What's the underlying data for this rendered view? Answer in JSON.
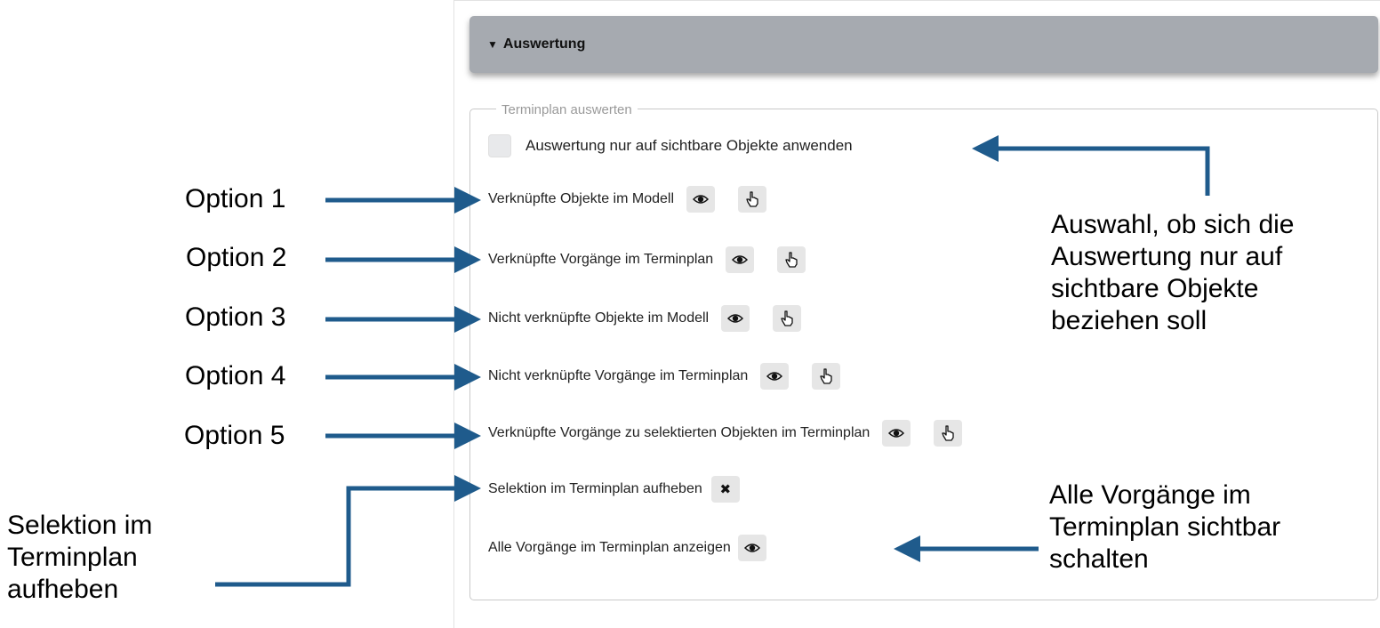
{
  "accordion": {
    "toggle_glyph": "▼",
    "title": "Auswertung"
  },
  "fieldset": {
    "legend": "Terminplan auswerten",
    "checkbox_label": "Auswertung nur auf sichtbare Objekte anwenden",
    "checked": false
  },
  "rows": [
    {
      "label": "Verknüpfte Objekte im Modell",
      "icons": [
        "eye-icon",
        "pointer-hand-icon"
      ]
    },
    {
      "label": "Verknüpfte Vorgänge im Terminplan",
      "icons": [
        "eye-icon",
        "pointer-hand-icon"
      ]
    },
    {
      "label": "Nicht verknüpfte Objekte im Modell",
      "icons": [
        "eye-icon",
        "pointer-hand-icon"
      ]
    },
    {
      "label": "Nicht verknüpfte Vorgänge im Terminplan",
      "icons": [
        "eye-icon",
        "pointer-hand-icon"
      ]
    },
    {
      "label": "Verknüpfte Vorgänge zu selektierten Objekten im Terminplan",
      "icons": [
        "eye-icon",
        "pointer-hand-icon"
      ]
    },
    {
      "label": "Selektion im Terminplan aufheben",
      "icons": [
        "close-icon"
      ],
      "close_glyph": "✖"
    },
    {
      "label": "Alle Vorgänge im Terminplan anzeigen",
      "icons": [
        "eye-icon"
      ]
    }
  ],
  "annotations": {
    "options": [
      "Option 1",
      "Option 2",
      "Option 3",
      "Option 4",
      "Option 5"
    ],
    "selektion_note": [
      "Selektion im",
      "Terminplan",
      "aufheben"
    ],
    "auswahl_note": [
      "Auswahl, ob sich die",
      "Auswertung nur auf",
      "sichtbare Objekte",
      "beziehen soll"
    ],
    "alle_note": [
      "Alle Vorgänge im",
      "Terminplan sichtbar",
      "schalten"
    ],
    "arrow_color": "#1f5b8c"
  }
}
